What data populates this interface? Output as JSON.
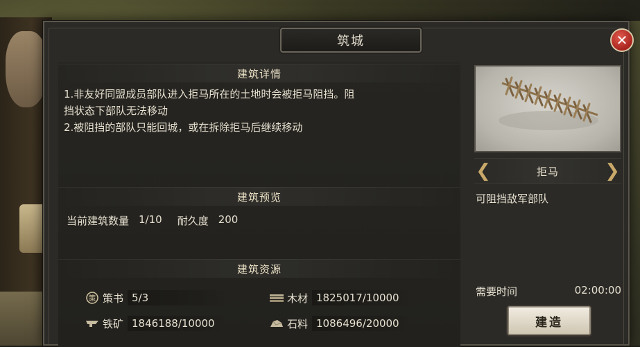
{
  "dialog": {
    "title": "筑城",
    "close_label": "✕"
  },
  "details": {
    "header": "建筑详情",
    "lines": [
      "1.非友好同盟成员部队进入拒马所在的土地时会被拒马阻挡。阻",
      "挡状态下部队无法移动",
      "2.被阻挡的部队只能回城，或在拆除拒马后继续移动"
    ]
  },
  "preview": {
    "header": "建筑预览",
    "count_label": "当前建筑数量",
    "count_value": "1/10",
    "durability_label": "耐久度",
    "durability_value": "200"
  },
  "resources": {
    "header": "建筑资源",
    "items": [
      {
        "icon": "scroll-icon",
        "label": "策书",
        "value": "5/3"
      },
      {
        "icon": "wood-icon",
        "label": "木材",
        "value": "1825017/10000"
      },
      {
        "icon": "iron-icon",
        "label": "铁矿",
        "value": "1846188/10000"
      },
      {
        "icon": "stone-icon",
        "label": "石料",
        "value": "1086496/20000"
      }
    ]
  },
  "building": {
    "name": "拒马",
    "description": "可阻挡敌军部队",
    "time_label": "需要时间",
    "time_value": "02:00:00",
    "build_label": "建造",
    "prev_arrow": "❮",
    "next_arrow": "❯"
  },
  "colors": {
    "accent_gold": "#c9a96a",
    "close_red": "#c0352b",
    "panel_bg": "#2b2a26"
  }
}
